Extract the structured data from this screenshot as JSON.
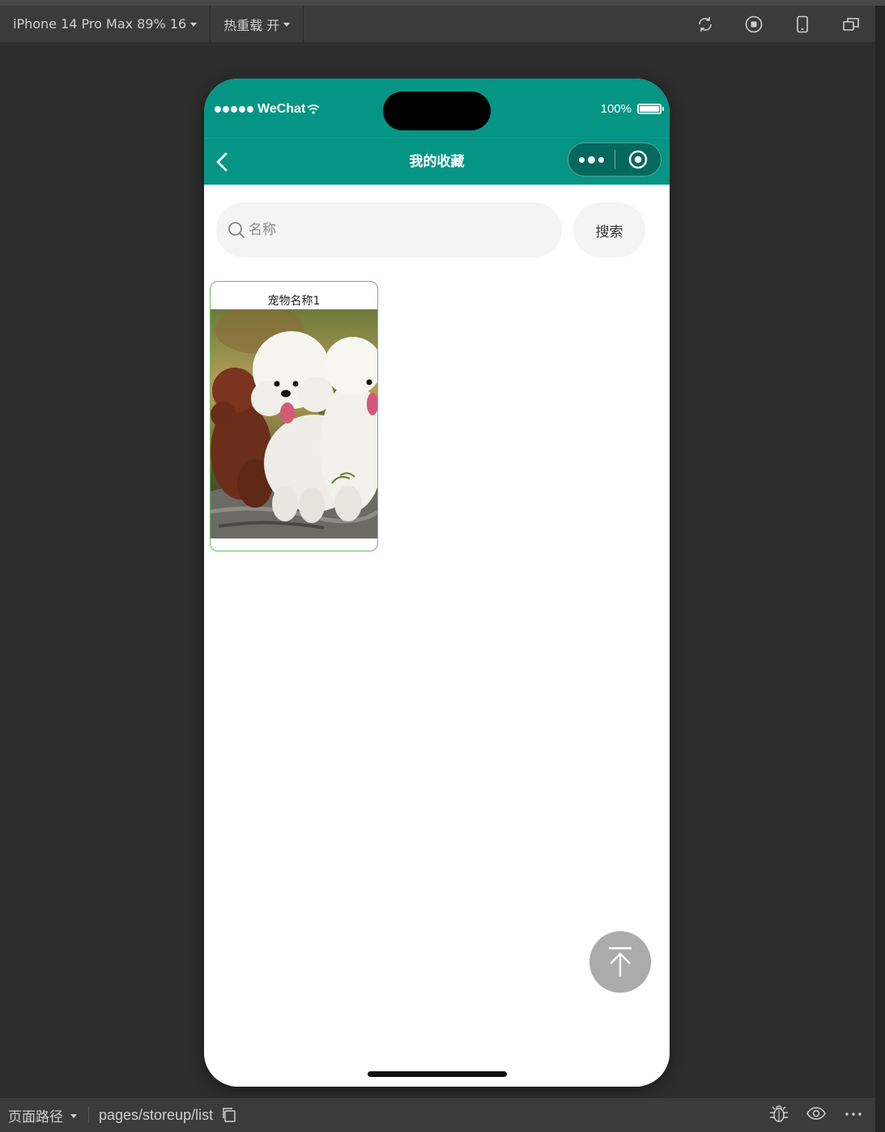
{
  "toolbar": {
    "device": "iPhone 14 Pro Max 89% 16",
    "hot_reload": "热重载 开",
    "icons": [
      "refresh-icon",
      "stop-icon",
      "phone-icon",
      "windows-icon"
    ]
  },
  "statusbar": {
    "carrier": "WeChat",
    "battery": "100%"
  },
  "navbar": {
    "title": "我的收藏"
  },
  "search": {
    "placeholder": "名称",
    "value": "",
    "button": "搜索"
  },
  "items": [
    {
      "title": "宠物名称1",
      "image": "white-poodle-dogs-photo"
    }
  ],
  "bottombar": {
    "path_label": "页面路径",
    "path": "pages/storeup/list",
    "icons": [
      "copy-icon",
      "debug-icon",
      "eye-icon",
      "more-icon"
    ]
  },
  "colors": {
    "theme": "#059585",
    "card_border": "#66bb6a",
    "back_top": "#ababab"
  }
}
